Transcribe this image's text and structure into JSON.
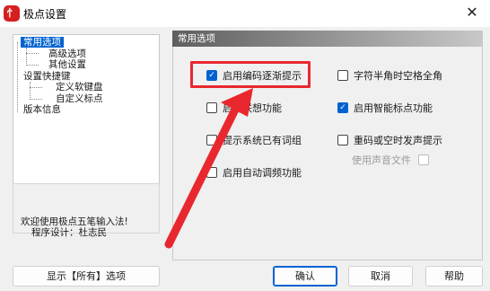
{
  "window": {
    "title": "极点设置",
    "app_icon_glyph": "忄",
    "close_glyph": "✕"
  },
  "tree": {
    "items": [
      {
        "label": "常用选项",
        "selected": true
      },
      {
        "label": "高级选项"
      },
      {
        "label": "其他设置"
      },
      {
        "label": "设置快捷键"
      },
      {
        "label": "定义软键盘"
      },
      {
        "label": "自定义标点"
      },
      {
        "label": "版本信息"
      }
    ]
  },
  "info": {
    "line1": "欢迎使用极点五笔输入法!",
    "line2": "程序设计：杜志民"
  },
  "panel": {
    "header": "常用选项",
    "options": {
      "encoding_hint": {
        "label": "启用编码逐渐提示",
        "checked": true
      },
      "halfwidth_space": {
        "label": "字符半角时空格全角",
        "checked": false
      },
      "association": {
        "label": "启用联想功能",
        "checked": false
      },
      "smart_punct": {
        "label": "启用智能标点功能",
        "checked": true
      },
      "hint_existing": {
        "label": "提示系统已有词组",
        "checked": false
      },
      "sound_on_error": {
        "label": "重码或空时发声提示",
        "checked": false
      },
      "auto_freq": {
        "label": "启用自动调频功能",
        "checked": false
      },
      "use_sound_file": {
        "label": "使用声音文件",
        "checked": false
      }
    }
  },
  "buttons": {
    "show_all": "显示【所有】选项",
    "ok": "确认",
    "cancel": "取消",
    "help": "帮助"
  },
  "annotation": {
    "color": "#e8282e"
  },
  "colors": {
    "selection": "#0063d1",
    "checkbox_checked": "#0063d1"
  }
}
